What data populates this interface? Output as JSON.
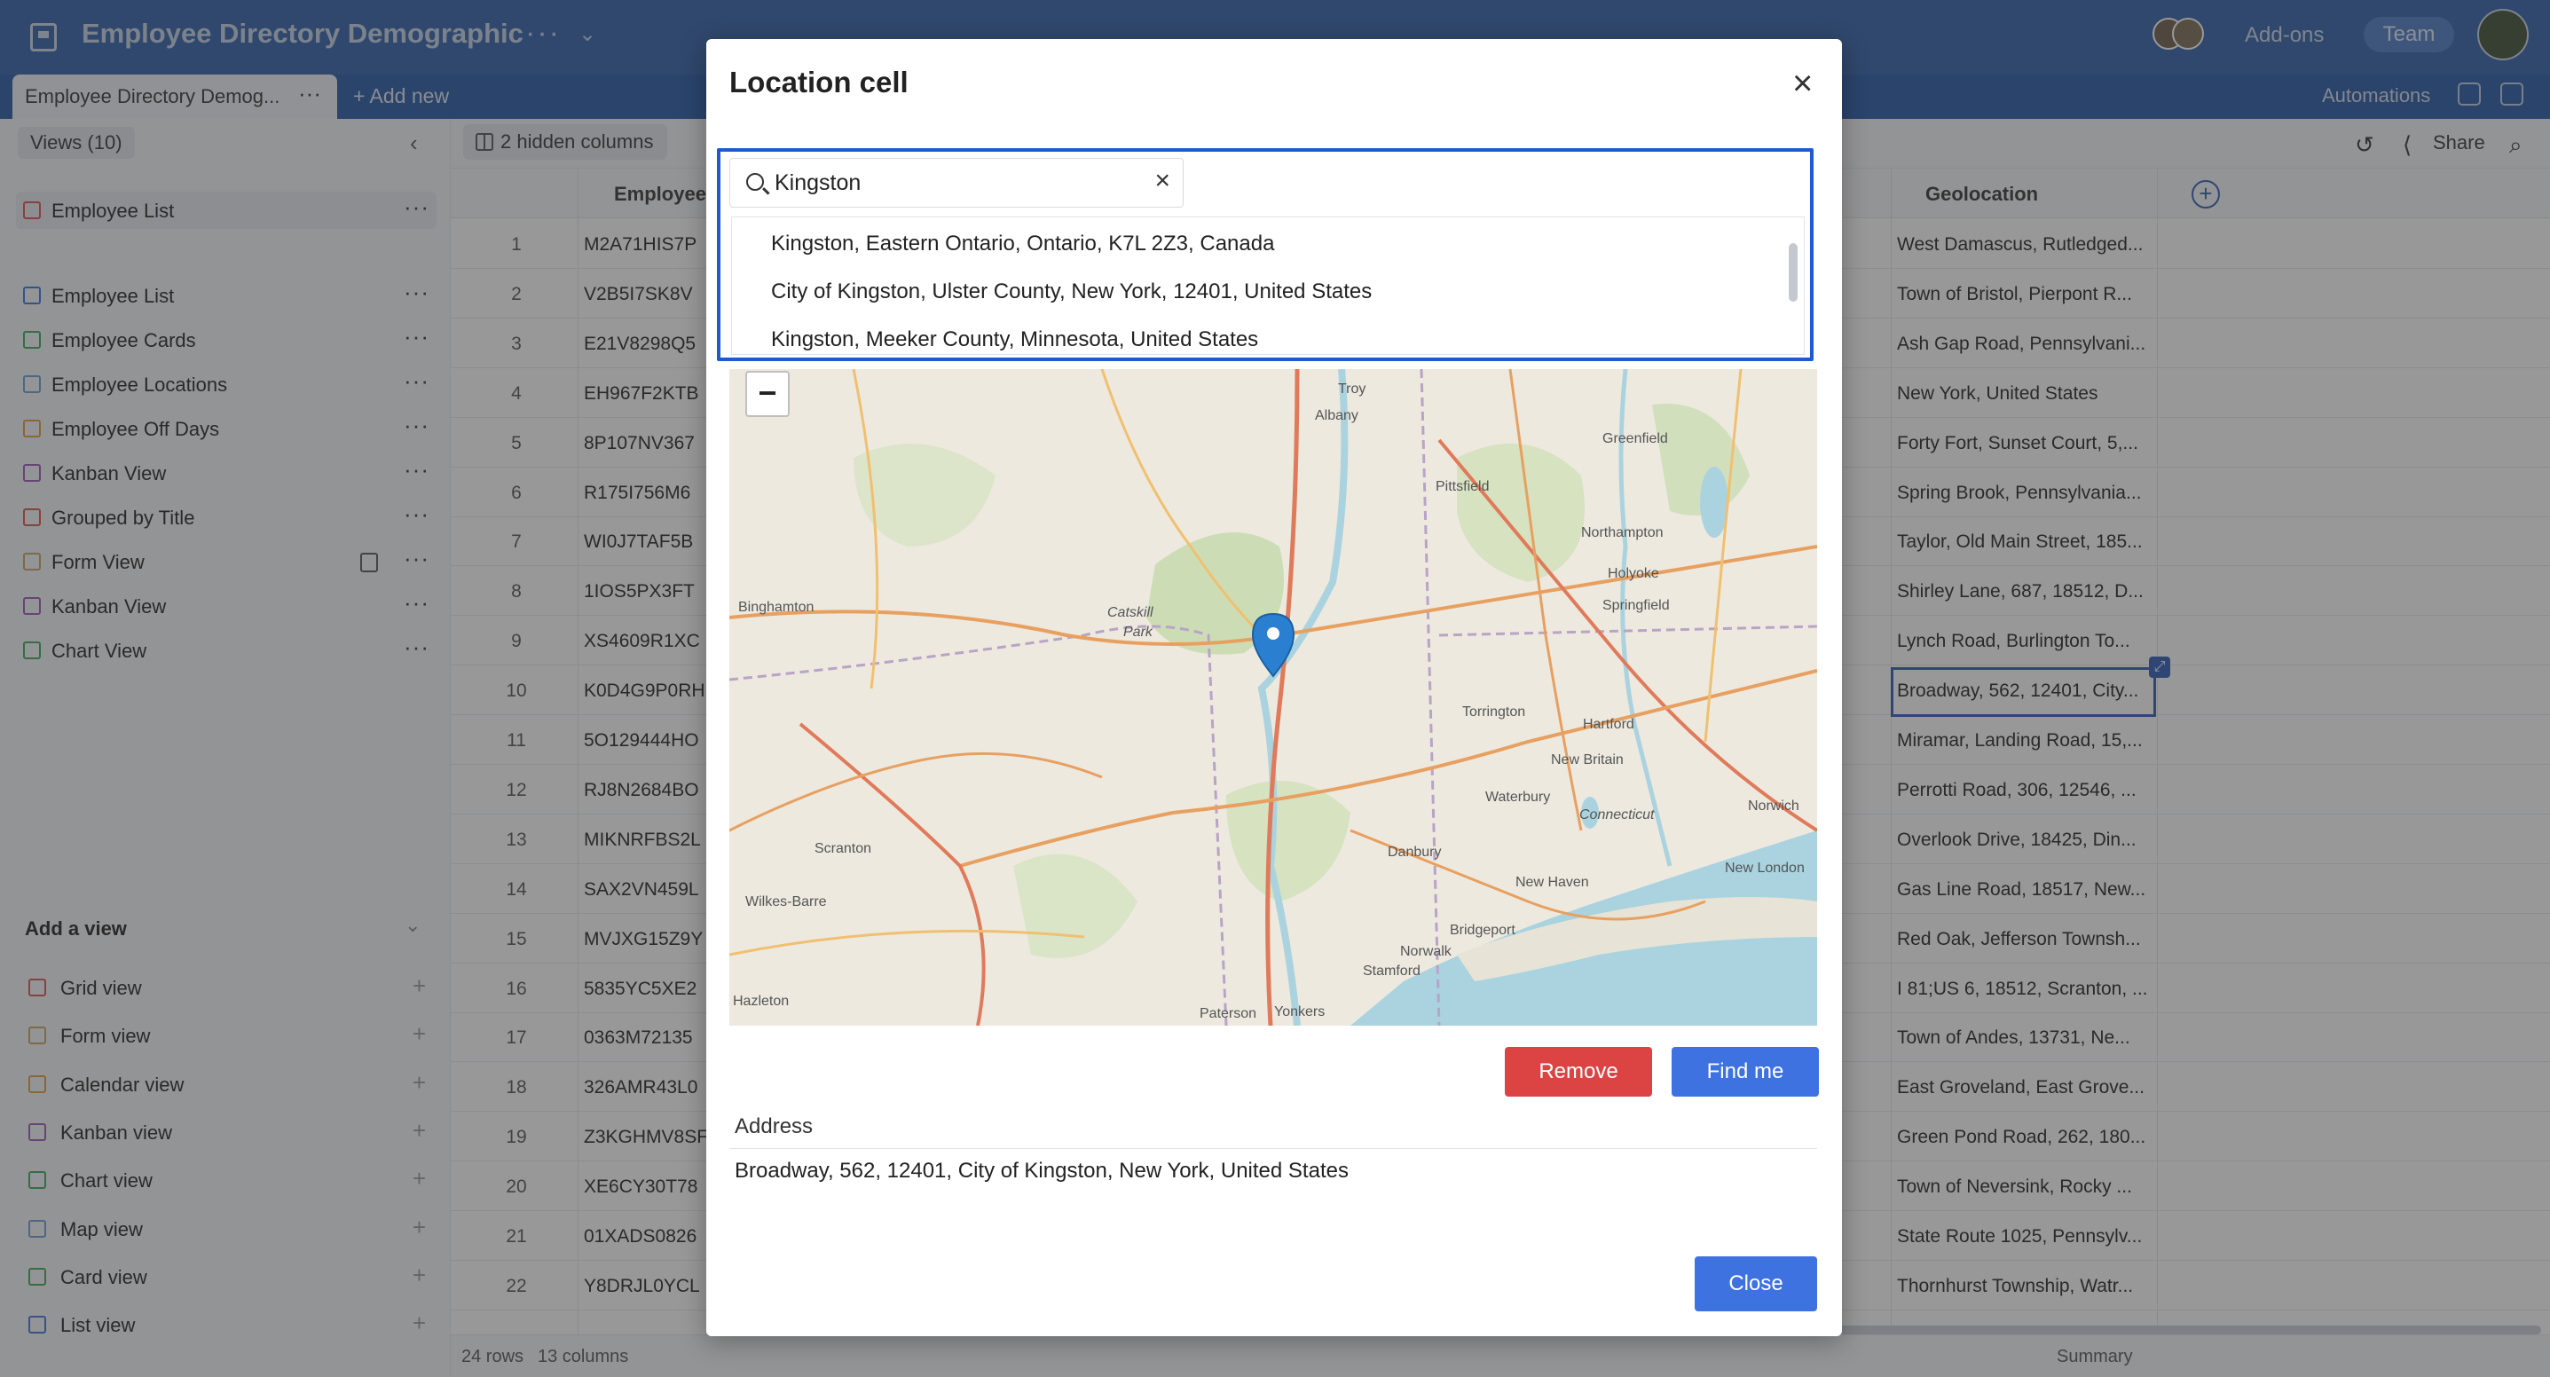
{
  "app": {
    "title": "Employee Directory Demographic",
    "addons_label": "Add-ons",
    "team_label": "Team"
  },
  "tabs": {
    "active_label": "Employee Directory Demog...",
    "add_new_label": "+ Add new",
    "automations_label": "Automations"
  },
  "sidebar": {
    "views_count": "Views (10)",
    "views": [
      {
        "label": "Employee List",
        "icon": "grid-icon",
        "color": "#d9534f"
      },
      {
        "label": "Employee List",
        "icon": "list-icon",
        "color": "#3d72e0"
      },
      {
        "label": "Employee Cards",
        "icon": "card-icon",
        "color": "#3aa65a"
      },
      {
        "label": "Employee Locations",
        "icon": "map-icon",
        "color": "#6b9bd8"
      },
      {
        "label": "Employee Off Days",
        "icon": "calendar-icon",
        "color": "#e09b3d"
      },
      {
        "label": "Kanban View",
        "icon": "kanban-icon",
        "color": "#9b59b6"
      },
      {
        "label": "Grouped by Title",
        "icon": "grid-icon",
        "color": "#d9534f"
      },
      {
        "label": "Form View",
        "icon": "form-icon",
        "color": "#c9a25a"
      },
      {
        "label": "Kanban View",
        "icon": "kanban-icon",
        "color": "#9b59b6"
      },
      {
        "label": "Chart View",
        "icon": "chart-icon",
        "color": "#3aa65a"
      }
    ],
    "add_view_label": "Add a view",
    "add_view_types": [
      {
        "label": "Grid view",
        "icon": "grid-icon",
        "color": "#d9534f"
      },
      {
        "label": "Form view",
        "icon": "form-icon",
        "color": "#c9a25a"
      },
      {
        "label": "Calendar view",
        "icon": "calendar-icon",
        "color": "#e09b3d"
      },
      {
        "label": "Kanban view",
        "icon": "kanban-icon",
        "color": "#9b59b6"
      },
      {
        "label": "Chart view",
        "icon": "chart-icon",
        "color": "#3aa65a"
      },
      {
        "label": "Map view",
        "icon": "map-icon",
        "color": "#6b9bd8"
      },
      {
        "label": "Card view",
        "icon": "card-icon",
        "color": "#3aa65a"
      },
      {
        "label": "List view",
        "icon": "list-icon",
        "color": "#3d72e0"
      }
    ]
  },
  "toolbar": {
    "hidden_columns": "2 hidden columns",
    "share_label": "Share"
  },
  "grid": {
    "col_employee": "Employee",
    "col_geolocation": "Geolocation",
    "rows": [
      {
        "n": "1",
        "id": "M2A71HIS7P",
        "geo": "West Damascus, Rutledged..."
      },
      {
        "n": "2",
        "id": "V2B5I7SK8V",
        "geo": "Town of Bristol, Pierpont R..."
      },
      {
        "n": "3",
        "id": "E21V8298Q5",
        "geo": "Ash Gap Road, Pennsylvani..."
      },
      {
        "n": "4",
        "id": "EH967F2KTB",
        "geo": "New York, United States"
      },
      {
        "n": "5",
        "id": "8P107NV367",
        "geo": "Forty Fort, Sunset Court, 5,..."
      },
      {
        "n": "6",
        "id": "R175I756M6",
        "geo": "Spring Brook, Pennsylvania..."
      },
      {
        "n": "7",
        "id": "WI0J7TAF5B",
        "geo": "Taylor, Old Main Street, 185..."
      },
      {
        "n": "8",
        "id": "1IOS5PX3FT",
        "geo": "Shirley Lane, 687, 18512, D..."
      },
      {
        "n": "9",
        "id": "XS4609R1XC",
        "geo": "Lynch Road, Burlington To..."
      },
      {
        "n": "10",
        "id": "K0D4G9P0RH",
        "geo": "Broadway, 562, 12401, City..."
      },
      {
        "n": "11",
        "id": "5O129444HO",
        "geo": "Miramar, Landing Road, 15,..."
      },
      {
        "n": "12",
        "id": "RJ8N2684BO",
        "geo": "Perrotti Road, 306, 12546, ..."
      },
      {
        "n": "13",
        "id": "MIKNRFBS2L",
        "geo": "Overlook Drive, 18425, Din..."
      },
      {
        "n": "14",
        "id": "SAX2VN459L",
        "geo": "Gas Line Road, 18517, New..."
      },
      {
        "n": "15",
        "id": "MVJXG15Z9Y",
        "geo": "Red Oak, Jefferson Townsh..."
      },
      {
        "n": "16",
        "id": "5835YC5XE2",
        "geo": "I 81;US 6, 18512, Scranton, ..."
      },
      {
        "n": "17",
        "id": "0363M72135",
        "geo": "Town of Andes, 13731, Ne..."
      },
      {
        "n": "18",
        "id": "326AMR43L0",
        "geo": "East Groveland, East Grove..."
      },
      {
        "n": "19",
        "id": "Z3KGHMV8SF",
        "geo": "Green Pond Road, 262, 180..."
      },
      {
        "n": "20",
        "id": "XE6CY30T78",
        "geo": "Town of Neversink, Rocky ..."
      },
      {
        "n": "21",
        "id": "01XADS0826",
        "geo": "State Route 1025, Pennsylv..."
      },
      {
        "n": "22",
        "id": "Y8DRJL0YCL",
        "geo": "Thornhurst Township, Watr..."
      }
    ],
    "footer_rows": "24 rows",
    "footer_cols": "13 columns",
    "summary_label": "Summary"
  },
  "modal": {
    "title": "Location cell",
    "search_value": "Kingston",
    "suggestions": [
      "Kingston, Eastern Ontario, Ontario, K7L 2Z3, Canada",
      "City of Kingston, Ulster County, New York, 12401, United States",
      "Kingston, Meeker County, Minnesota, United States"
    ],
    "map_labels": [
      "Troy",
      "Albany",
      "Greenfield",
      "Pittsfield",
      "Northampton",
      "Holyoke",
      "Springfield",
      "Binghamton",
      "Catskill",
      "Park",
      "Torrington",
      "Hartford",
      "New Britain",
      "Waterbury",
      "Norwich",
      "Connecticut",
      "Scranton",
      "Danbury",
      "Wilkes-Barre",
      "New Haven",
      "New London",
      "Bridgeport",
      "Norwalk",
      "Stamford",
      "Hazleton",
      "Paterson",
      "Yonkers"
    ],
    "remove_label": "Remove",
    "findme_label": "Find me",
    "address_label": "Address",
    "address_value": "Broadway, 562, 12401, City of Kingston, New York, United States",
    "close_label": "Close"
  }
}
